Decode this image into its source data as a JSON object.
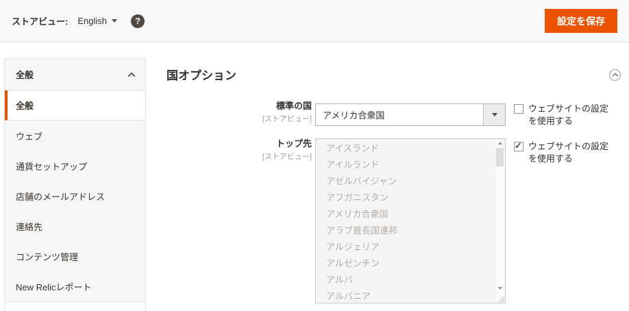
{
  "colors": {
    "accent": "#eb5202",
    "help_icon_bg": "#514943"
  },
  "topbar": {
    "store_view_label": "ストアビュー:",
    "store_switcher_value": "English",
    "help_glyph": "?",
    "save_button": "設定を保存"
  },
  "sidebar": {
    "section_label": "全般",
    "section_state": "expanded",
    "items": [
      {
        "label": "全般",
        "active": true
      },
      {
        "label": "ウェブ"
      },
      {
        "label": "通貨セットアップ"
      },
      {
        "label": "店舗のメールアドレス"
      },
      {
        "label": "連絡先"
      },
      {
        "label": "コンテンツ管理"
      },
      {
        "label": "New Relicレポート"
      }
    ]
  },
  "main": {
    "section_title": "国オプション",
    "fields": [
      {
        "label": "標準の国",
        "scope": "[ストアビュー]",
        "type": "select",
        "value": "アメリカ合衆国",
        "checkbox": {
          "label": "ウェブサイトの設定を使用する",
          "checked": false
        }
      },
      {
        "label": "トップ先",
        "scope": "[ストアビュー]",
        "type": "multiselect",
        "disabled": true,
        "options": [
          "アイスランド",
          "アイルランド",
          "アゼルバイジャン",
          "アフガニスタン",
          "アメリカ合衆国",
          "アラブ首長国連邦",
          "アルジェリア",
          "アルゼンチン",
          "アルバ",
          "アルバニア"
        ],
        "checkbox": {
          "label": "ウェブサイトの設定を使用する",
          "checked": true
        }
      }
    ]
  }
}
